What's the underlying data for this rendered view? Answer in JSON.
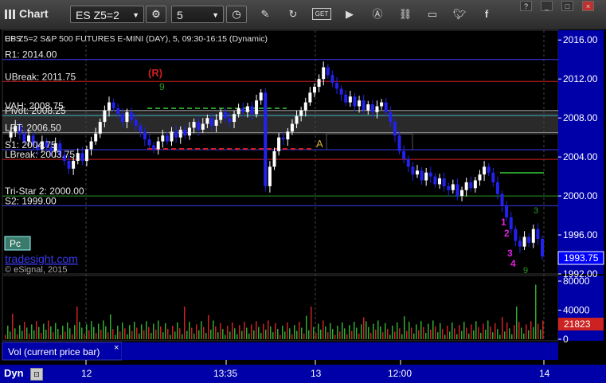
{
  "toolbar": {
    "title": "Chart",
    "symbol": "ES Z5=2",
    "interval": "5",
    "icons": [
      "chart-logo-icon",
      "symbol-dropdown-icon",
      "settings-gear-icon",
      "interval-dropdown-icon",
      "clock-icon",
      "draw-pen-icon",
      "refresh-icon",
      "get-data-icon",
      "play-icon",
      "alert-icon",
      "link-icon",
      "message-icon",
      "twitter-icon",
      "facebook-icon"
    ],
    "window_icons": [
      "question-icon",
      "minimize-icon",
      "maximize-icon",
      "close-icon"
    ]
  },
  "chart_data": {
    "type": "candlestick",
    "title": "ES Z5=2 S&P 500 FUTURES E-MINI (DAY), 5, 09:30-16:15 (Dynamic)",
    "title_visible_prefix": "UPS",
    "last_price": "1993.75",
    "price_axis_ticks": [
      "2016.00",
      "2012.00",
      "2008.00",
      "2004.00",
      "2000.00",
      "1996.00",
      "1992.00"
    ],
    "ylim": [
      1992.0,
      2017.0
    ],
    "volume_axis_ticks": [
      "80000",
      "40000",
      "0"
    ],
    "last_volume": "21823",
    "time_axis_labels": [
      "12",
      "13:35",
      "13",
      "12:00",
      "14"
    ],
    "levels": [
      {
        "label": "R1: 2014.00",
        "value": 2014.0,
        "color": "#3a3af0"
      },
      {
        "label": "UBreak: 2011.75",
        "value": 2011.75,
        "color": "#d02020"
      },
      {
        "label": "VAH: 2008.75",
        "value": 2008.75,
        "color": "#cfcfcf",
        "label_text": "VAH: 2008.75"
      },
      {
        "label": "Pivot: 2008.25",
        "value": 2008.25,
        "color": "#3ab0c0"
      },
      {
        "label": "LPT: 2006.50",
        "value": 2006.5,
        "color": "#888888"
      },
      {
        "label": "S1: 2004.75",
        "value": 2004.75,
        "color": "#3a3af0"
      },
      {
        "label": "LBreak: 2003.75",
        "value": 2003.75,
        "color": "#d02020"
      },
      {
        "label": "Tri-Star 2: 2000.00",
        "value": 2000.0,
        "color": "#2a9a2a"
      },
      {
        "label": "S2: 1999.00",
        "value": 1999.0,
        "color": "#3a3af0"
      }
    ],
    "annotations": [
      {
        "text": "(R)",
        "color": "#d02020"
      },
      {
        "text": "9",
        "color": "#2a9a2a"
      },
      {
        "text": "A",
        "color": "#d8b040"
      },
      {
        "text": "1",
        "color": "#e020e0"
      },
      {
        "text": "2",
        "color": "#e020e0"
      },
      {
        "text": "3",
        "color": "#e020e0"
      },
      {
        "text": "4",
        "color": "#e020e0"
      },
      {
        "text": "9",
        "color": "#2a9a2a"
      },
      {
        "text": "3",
        "color": "#2a9a2a"
      }
    ],
    "brand_box": "Pc",
    "brand_text": "tradesight.com",
    "copyright": "© eSignal, 2015",
    "volume_label": "Vol (current price bar)",
    "volume_close": "×",
    "status_left": "Dyn",
    "colors": {
      "up": "#ffffff",
      "down": "#2222ee",
      "volume_up": "#33aa33",
      "volume_down": "#cc2222"
    }
  }
}
